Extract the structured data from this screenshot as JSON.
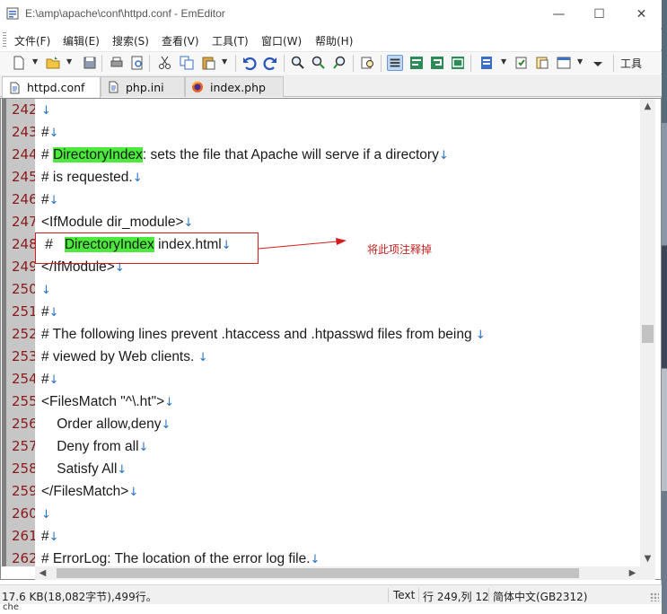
{
  "window": {
    "title": "E:\\amp\\apache\\conf\\httpd.conf - EmEditor",
    "min_glyph": "—",
    "max_glyph": "☐",
    "close_glyph": "✕"
  },
  "menu": {
    "items": [
      {
        "label": "文件(F)"
      },
      {
        "label": "编辑(E)"
      },
      {
        "label": "搜索(S)"
      },
      {
        "label": "查看(V)"
      },
      {
        "label": "工具(T)"
      },
      {
        "label": "窗口(W)"
      },
      {
        "label": "帮助(H)"
      }
    ]
  },
  "toolbar": {
    "overflow_label": "工具"
  },
  "tabs": [
    {
      "label": "httpd.conf",
      "icon": "document-icon",
      "active": true
    },
    {
      "label": "php.ini",
      "icon": "document-icon",
      "active": false
    },
    {
      "label": "index.php",
      "icon": "firefox-icon",
      "active": false
    }
  ],
  "editor": {
    "eol_glyph": "↓",
    "lines": [
      {
        "num": "242",
        "pre": "",
        "hl": "",
        "post": ""
      },
      {
        "num": "243",
        "pre": "#",
        "hl": "",
        "post": ""
      },
      {
        "num": "244",
        "pre": "# ",
        "hl": "DirectoryIndex",
        "post": ": sets the file that Apache will serve if a directory"
      },
      {
        "num": "245",
        "pre": "# is requested.",
        "hl": "",
        "post": ""
      },
      {
        "num": "246",
        "pre": "#",
        "hl": "",
        "post": ""
      },
      {
        "num": "247",
        "pre": "<IfModule dir_module>",
        "hl": "",
        "post": ""
      },
      {
        "num": "248",
        "pre": " #   ",
        "hl": "DirectoryIndex",
        "post": " index.html"
      },
      {
        "num": "249",
        "pre": "</IfModule>",
        "hl": "",
        "post": ""
      },
      {
        "num": "250",
        "pre": "",
        "hl": "",
        "post": ""
      },
      {
        "num": "251",
        "pre": "#",
        "hl": "",
        "post": ""
      },
      {
        "num": "252",
        "pre": "# The following lines prevent .htaccess and .htpasswd files from being ",
        "hl": "",
        "post": ""
      },
      {
        "num": "253",
        "pre": "# viewed by Web clients. ",
        "hl": "",
        "post": ""
      },
      {
        "num": "254",
        "pre": "#",
        "hl": "",
        "post": ""
      },
      {
        "num": "255",
        "pre": "<FilesMatch \"^\\.ht\">",
        "hl": "",
        "post": ""
      },
      {
        "num": "256",
        "pre": "    Order allow,deny",
        "hl": "",
        "post": ""
      },
      {
        "num": "257",
        "pre": "    Deny from all",
        "hl": "",
        "post": ""
      },
      {
        "num": "258",
        "pre": "    Satisfy All",
        "hl": "",
        "post": ""
      },
      {
        "num": "259",
        "pre": "</FilesMatch>",
        "hl": "",
        "post": ""
      },
      {
        "num": "260",
        "pre": "",
        "hl": "",
        "post": ""
      },
      {
        "num": "261",
        "pre": "#",
        "hl": "",
        "post": ""
      },
      {
        "num": "262",
        "pre": "# ErrorLog: The location of the error log file.",
        "hl": "",
        "post": ""
      }
    ],
    "highlight_color": "#4bea3d"
  },
  "annotation": {
    "text": "将此项注释掉",
    "color": "#c0211c"
  },
  "status": {
    "size": "17.6 KB(18,082字节),499行。",
    "mode": "Text",
    "position": "行 249,列 12",
    "encoding": "简体中文(GB2312)"
  },
  "below_status": "che"
}
